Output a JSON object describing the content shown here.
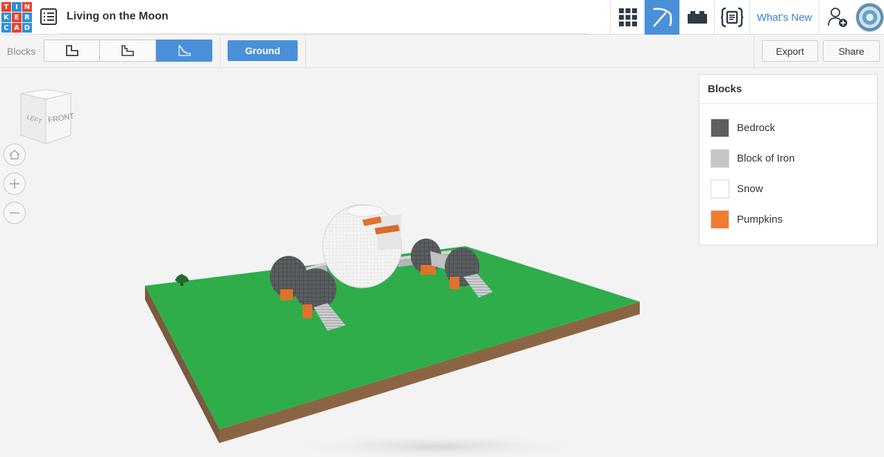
{
  "app": {
    "logo_letters": [
      "T",
      "I",
      "N",
      "K",
      "E",
      "R",
      "C",
      "A",
      "D"
    ],
    "logo_colors": [
      "#e8412c",
      "#2f8fd6",
      "#e8412c",
      "#2f8fd6",
      "#e8412c",
      "#2f8fd6",
      "#2f8fd6",
      "#e8412c",
      "#2f8fd6"
    ],
    "title": "Living on the Moon",
    "accent": "#4a90d9"
  },
  "topbar": {
    "icons": [
      "grid-view-icon",
      "pickaxe-icon",
      "brick-icon",
      "code-blocks-icon"
    ],
    "active": "pickaxe-icon",
    "whats_new": "What's New"
  },
  "toolbar": {
    "blocks_label": "Blocks",
    "ground_label": "Ground",
    "export_label": "Export",
    "share_label": "Share",
    "active_mode": 3
  },
  "viewcube": {
    "left": "LEFT",
    "front": "FRONT"
  },
  "blocks_panel": {
    "title": "Blocks",
    "items": [
      {
        "label": "Bedrock",
        "color": "#5c5f61"
      },
      {
        "label": "Block of Iron",
        "color": "#c4c6c8"
      },
      {
        "label": "Snow",
        "color": "#ffffff"
      },
      {
        "label": "Pumpkins",
        "color": "#f07d2f"
      }
    ]
  }
}
